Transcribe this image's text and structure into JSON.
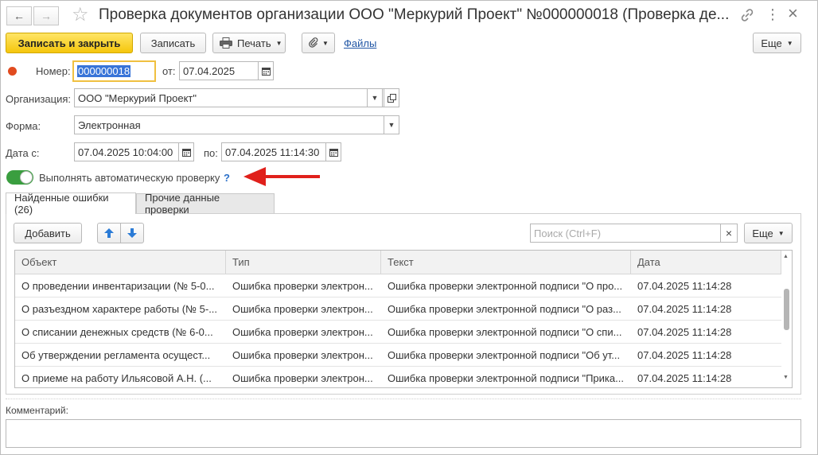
{
  "window": {
    "title": "Проверка документов организации ООО \"Меркурий Проект\" №000000018 (Проверка де...",
    "back_glyph": "←",
    "forward_glyph": "→",
    "star_glyph": "☆",
    "link_glyph": "🔗",
    "more_glyph": "⋮",
    "close_glyph": "×"
  },
  "toolbar": {
    "save_close_label": "Записать и закрыть",
    "save_label": "Записать",
    "print_label": "Печать",
    "files_label": "Файлы",
    "more_label": "Еще"
  },
  "form": {
    "number_label": "Номер:",
    "number_value": "000000018",
    "from_label": "от:",
    "date_value": "07.04.2025",
    "org_label": "Организация:",
    "org_value": "ООО \"Меркурий Проект\"",
    "form_label": "Форма:",
    "form_value": "Электронная",
    "date_from_label": "Дата с:",
    "date_from_value": "07.04.2025 10:04:00",
    "date_to_label": "по:",
    "date_to_value": "07.04.2025 11:14:30",
    "auto_check_label": "Выполнять автоматическую проверку",
    "help_glyph": "?"
  },
  "tabs": [
    {
      "label": "Найденные ошибки (26)"
    },
    {
      "label": "Прочие данные проверки"
    }
  ],
  "table_toolbar": {
    "add_label": "Добавить",
    "up_glyph": "🡅",
    "down_glyph": "🡇",
    "search_placeholder": "Поиск (Ctrl+F)",
    "clear_glyph": "×",
    "more_label": "Еще"
  },
  "table": {
    "columns": [
      "Объект",
      "Тип",
      "Текст",
      "Дата"
    ],
    "rows": [
      {
        "object": "О проведении инвентаризации (№ 5-0...",
        "type": "Ошибка проверки электрон...",
        "text": "Ошибка проверки электронной подписи \"О про...",
        "date": "07.04.2025 11:14:28"
      },
      {
        "object": "О разъездном характере работы (№ 5-...",
        "type": "Ошибка проверки электрон...",
        "text": "Ошибка проверки электронной подписи \"О раз...",
        "date": "07.04.2025 11:14:28"
      },
      {
        "object": "О списании денежных средств (№ 6-0...",
        "type": "Ошибка проверки электрон...",
        "text": "Ошибка проверки электронной подписи \"О спи...",
        "date": "07.04.2025 11:14:28"
      },
      {
        "object": "Об утверждении регламента осущест...",
        "type": "Ошибка проверки электрон...",
        "text": "Ошибка проверки электронной подписи \"Об ут...",
        "date": "07.04.2025 11:14:28"
      },
      {
        "object": "О приеме на работу Ильясовой А.Н. (...",
        "type": "Ошибка проверки электрон...",
        "text": "Ошибка проверки электронной подписи \"Прика...",
        "date": "07.04.2025 11:14:28"
      }
    ]
  },
  "comment": {
    "label": "Комментарий:",
    "value": ""
  },
  "colors": {
    "primary_button": "#f5c60c",
    "link": "#2156a5",
    "toggle_on": "#3a9e3f",
    "arrow": "#e0201b",
    "status_dot": "#e14b1f"
  }
}
